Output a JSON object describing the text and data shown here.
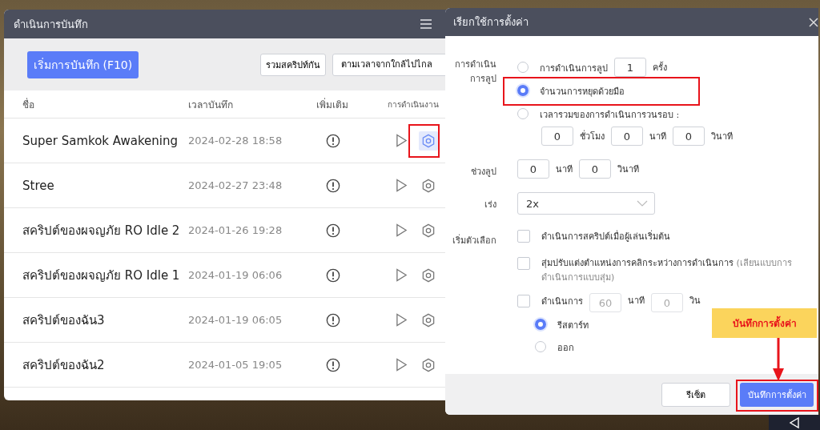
{
  "record_panel": {
    "title": "ดำเนินการบันทึก",
    "start_button": "เริ่มการบันทึก (F10)",
    "merge_button": "รวมสคริปท์กัน",
    "sort_select": {
      "value": "ตามเวลาจากใกล้ไปไกล"
    },
    "columns": [
      "ชื่อ",
      "เวลาบันทึก",
      "เพิ่มเติม",
      "การดำเนินงาน"
    ],
    "rows": [
      {
        "name": "Super Samkok Awakening",
        "time": "2024-02-28 18:58",
        "selected": true
      },
      {
        "name": "Stree",
        "time": "2024-02-27 23:48",
        "selected": false
      },
      {
        "name": "สคริปต์ของผจญภัย RO Idle 2",
        "time": "2024-01-26 19:28",
        "selected": false
      },
      {
        "name": "สคริปต์ของผจญภัย RO Idle 1",
        "time": "2024-01-19 06:06",
        "selected": false
      },
      {
        "name": "สคริปต์ของฉัน3",
        "time": "2024-01-19 06:05",
        "selected": false
      },
      {
        "name": "สคริปต์ของฉัน2",
        "time": "2024-01-05 19:05",
        "selected": false
      }
    ]
  },
  "settings_dialog": {
    "title": "เรียกใช้การตั้งค่า",
    "loop": {
      "label": "การดำเนินการลูป",
      "options": [
        {
          "kind": "count",
          "label": "การดำเนินการลูป",
          "value": "1",
          "unit": "ครั้ง",
          "selected": false
        },
        {
          "kind": "plain",
          "label": "จำนวนการหยุดด้วยมือ",
          "selected": true
        },
        {
          "kind": "duration",
          "label": "เวลารวมของการดำเนินการวนรอบ :",
          "fields": [
            {
              "value": "0",
              "unit": "ชั่วโมง"
            },
            {
              "value": "0",
              "unit": "นาที"
            },
            {
              "value": "0",
              "unit": "วินาที"
            }
          ],
          "selected": false
        }
      ]
    },
    "interval": {
      "label": "ช่วงลูป",
      "fields": [
        {
          "value": "0",
          "unit": "นาที"
        },
        {
          "value": "0",
          "unit": "วินาที"
        }
      ]
    },
    "speed": {
      "label": "เร่ง",
      "value": "2x"
    },
    "options": {
      "label": "เริ่มตัวเลือก",
      "items": [
        {
          "kind": "plain",
          "label": "ดำเนินการสคริปต์เมื่อผู้เล่นเริ่มต้น",
          "checked": false
        },
        {
          "kind": "note",
          "label": "สุ่มปรับแต่งตำแหน่งการคลิกระหว่างการดำเนินการ",
          "note": "(เลียนแบบการดำเนินการแบบสุ่ม)",
          "checked": false
        },
        {
          "kind": "timer",
          "label": "ดำเนินการ",
          "fields": [
            {
              "value": "60",
              "unit": "นาที",
              "disabled": true
            },
            {
              "value": "0",
              "unit": "วิน",
              "disabled": true
            }
          ],
          "checked": false,
          "choices": [
            {
              "label": "รีสตาร์ท",
              "selected": true
            },
            {
              "label": "ออก",
              "selected": false
            }
          ]
        }
      ]
    },
    "buttons": {
      "reset": "รีเซ็ต",
      "save": "บันทึกการตั้งค่า"
    }
  },
  "annotation": {
    "callout": "บันทึกการตั้งค่า"
  }
}
